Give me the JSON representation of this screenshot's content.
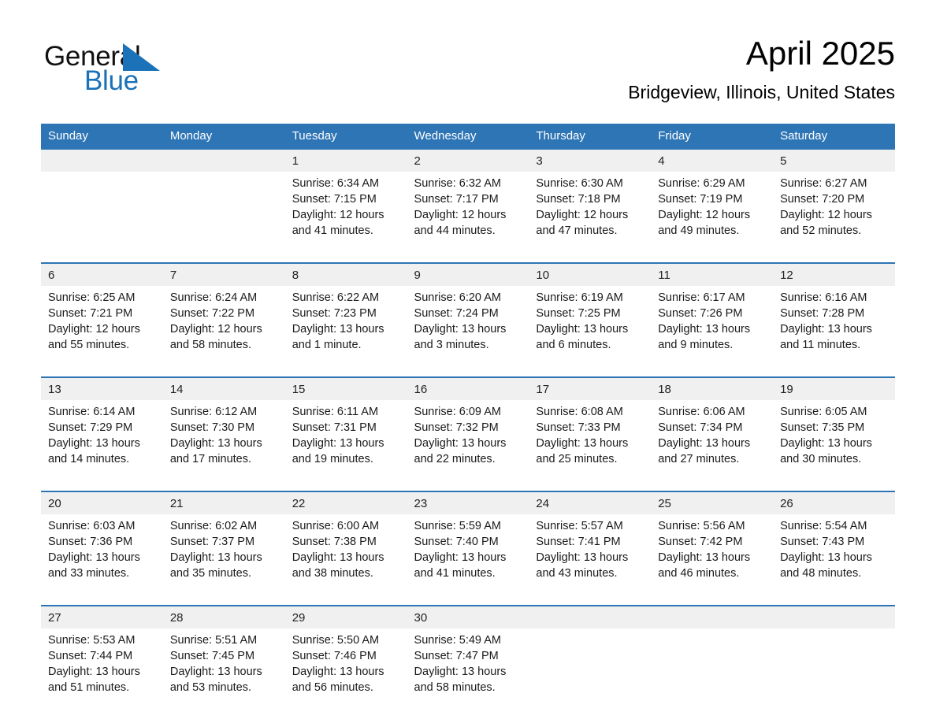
{
  "brand": {
    "name_part1": "General",
    "name_part2": "Blue",
    "accent_color": "#1b72b8"
  },
  "header": {
    "month_title": "April 2025",
    "location": "Bridgeview, Illinois, United States"
  },
  "theme": {
    "header_blue": "#2e75b6",
    "date_band_gray": "#f0f0f0",
    "page_background": "#ffffff"
  },
  "weekday_headers": [
    "Sunday",
    "Monday",
    "Tuesday",
    "Wednesday",
    "Thursday",
    "Friday",
    "Saturday"
  ],
  "weeks": [
    {
      "days": [
        {
          "date": "",
          "sunrise": "",
          "sunset": "",
          "daylight_line1": "",
          "daylight_line2": ""
        },
        {
          "date": "",
          "sunrise": "",
          "sunset": "",
          "daylight_line1": "",
          "daylight_line2": ""
        },
        {
          "date": "1",
          "sunrise": "Sunrise: 6:34 AM",
          "sunset": "Sunset: 7:15 PM",
          "daylight_line1": "Daylight: 12 hours",
          "daylight_line2": "and 41 minutes."
        },
        {
          "date": "2",
          "sunrise": "Sunrise: 6:32 AM",
          "sunset": "Sunset: 7:17 PM",
          "daylight_line1": "Daylight: 12 hours",
          "daylight_line2": "and 44 minutes."
        },
        {
          "date": "3",
          "sunrise": "Sunrise: 6:30 AM",
          "sunset": "Sunset: 7:18 PM",
          "daylight_line1": "Daylight: 12 hours",
          "daylight_line2": "and 47 minutes."
        },
        {
          "date": "4",
          "sunrise": "Sunrise: 6:29 AM",
          "sunset": "Sunset: 7:19 PM",
          "daylight_line1": "Daylight: 12 hours",
          "daylight_line2": "and 49 minutes."
        },
        {
          "date": "5",
          "sunrise": "Sunrise: 6:27 AM",
          "sunset": "Sunset: 7:20 PM",
          "daylight_line1": "Daylight: 12 hours",
          "daylight_line2": "and 52 minutes."
        }
      ]
    },
    {
      "days": [
        {
          "date": "6",
          "sunrise": "Sunrise: 6:25 AM",
          "sunset": "Sunset: 7:21 PM",
          "daylight_line1": "Daylight: 12 hours",
          "daylight_line2": "and 55 minutes."
        },
        {
          "date": "7",
          "sunrise": "Sunrise: 6:24 AM",
          "sunset": "Sunset: 7:22 PM",
          "daylight_line1": "Daylight: 12 hours",
          "daylight_line2": "and 58 minutes."
        },
        {
          "date": "8",
          "sunrise": "Sunrise: 6:22 AM",
          "sunset": "Sunset: 7:23 PM",
          "daylight_line1": "Daylight: 13 hours",
          "daylight_line2": "and 1 minute."
        },
        {
          "date": "9",
          "sunrise": "Sunrise: 6:20 AM",
          "sunset": "Sunset: 7:24 PM",
          "daylight_line1": "Daylight: 13 hours",
          "daylight_line2": "and 3 minutes."
        },
        {
          "date": "10",
          "sunrise": "Sunrise: 6:19 AM",
          "sunset": "Sunset: 7:25 PM",
          "daylight_line1": "Daylight: 13 hours",
          "daylight_line2": "and 6 minutes."
        },
        {
          "date": "11",
          "sunrise": "Sunrise: 6:17 AM",
          "sunset": "Sunset: 7:26 PM",
          "daylight_line1": "Daylight: 13 hours",
          "daylight_line2": "and 9 minutes."
        },
        {
          "date": "12",
          "sunrise": "Sunrise: 6:16 AM",
          "sunset": "Sunset: 7:28 PM",
          "daylight_line1": "Daylight: 13 hours",
          "daylight_line2": "and 11 minutes."
        }
      ]
    },
    {
      "days": [
        {
          "date": "13",
          "sunrise": "Sunrise: 6:14 AM",
          "sunset": "Sunset: 7:29 PM",
          "daylight_line1": "Daylight: 13 hours",
          "daylight_line2": "and 14 minutes."
        },
        {
          "date": "14",
          "sunrise": "Sunrise: 6:12 AM",
          "sunset": "Sunset: 7:30 PM",
          "daylight_line1": "Daylight: 13 hours",
          "daylight_line2": "and 17 minutes."
        },
        {
          "date": "15",
          "sunrise": "Sunrise: 6:11 AM",
          "sunset": "Sunset: 7:31 PM",
          "daylight_line1": "Daylight: 13 hours",
          "daylight_line2": "and 19 minutes."
        },
        {
          "date": "16",
          "sunrise": "Sunrise: 6:09 AM",
          "sunset": "Sunset: 7:32 PM",
          "daylight_line1": "Daylight: 13 hours",
          "daylight_line2": "and 22 minutes."
        },
        {
          "date": "17",
          "sunrise": "Sunrise: 6:08 AM",
          "sunset": "Sunset: 7:33 PM",
          "daylight_line1": "Daylight: 13 hours",
          "daylight_line2": "and 25 minutes."
        },
        {
          "date": "18",
          "sunrise": "Sunrise: 6:06 AM",
          "sunset": "Sunset: 7:34 PM",
          "daylight_line1": "Daylight: 13 hours",
          "daylight_line2": "and 27 minutes."
        },
        {
          "date": "19",
          "sunrise": "Sunrise: 6:05 AM",
          "sunset": "Sunset: 7:35 PM",
          "daylight_line1": "Daylight: 13 hours",
          "daylight_line2": "and 30 minutes."
        }
      ]
    },
    {
      "days": [
        {
          "date": "20",
          "sunrise": "Sunrise: 6:03 AM",
          "sunset": "Sunset: 7:36 PM",
          "daylight_line1": "Daylight: 13 hours",
          "daylight_line2": "and 33 minutes."
        },
        {
          "date": "21",
          "sunrise": "Sunrise: 6:02 AM",
          "sunset": "Sunset: 7:37 PM",
          "daylight_line1": "Daylight: 13 hours",
          "daylight_line2": "and 35 minutes."
        },
        {
          "date": "22",
          "sunrise": "Sunrise: 6:00 AM",
          "sunset": "Sunset: 7:38 PM",
          "daylight_line1": "Daylight: 13 hours",
          "daylight_line2": "and 38 minutes."
        },
        {
          "date": "23",
          "sunrise": "Sunrise: 5:59 AM",
          "sunset": "Sunset: 7:40 PM",
          "daylight_line1": "Daylight: 13 hours",
          "daylight_line2": "and 41 minutes."
        },
        {
          "date": "24",
          "sunrise": "Sunrise: 5:57 AM",
          "sunset": "Sunset: 7:41 PM",
          "daylight_line1": "Daylight: 13 hours",
          "daylight_line2": "and 43 minutes."
        },
        {
          "date": "25",
          "sunrise": "Sunrise: 5:56 AM",
          "sunset": "Sunset: 7:42 PM",
          "daylight_line1": "Daylight: 13 hours",
          "daylight_line2": "and 46 minutes."
        },
        {
          "date": "26",
          "sunrise": "Sunrise: 5:54 AM",
          "sunset": "Sunset: 7:43 PM",
          "daylight_line1": "Daylight: 13 hours",
          "daylight_line2": "and 48 minutes."
        }
      ]
    },
    {
      "days": [
        {
          "date": "27",
          "sunrise": "Sunrise: 5:53 AM",
          "sunset": "Sunset: 7:44 PM",
          "daylight_line1": "Daylight: 13 hours",
          "daylight_line2": "and 51 minutes."
        },
        {
          "date": "28",
          "sunrise": "Sunrise: 5:51 AM",
          "sunset": "Sunset: 7:45 PM",
          "daylight_line1": "Daylight: 13 hours",
          "daylight_line2": "and 53 minutes."
        },
        {
          "date": "29",
          "sunrise": "Sunrise: 5:50 AM",
          "sunset": "Sunset: 7:46 PM",
          "daylight_line1": "Daylight: 13 hours",
          "daylight_line2": "and 56 minutes."
        },
        {
          "date": "30",
          "sunrise": "Sunrise: 5:49 AM",
          "sunset": "Sunset: 7:47 PM",
          "daylight_line1": "Daylight: 13 hours",
          "daylight_line2": "and 58 minutes."
        },
        {
          "date": "",
          "sunrise": "",
          "sunset": "",
          "daylight_line1": "",
          "daylight_line2": ""
        },
        {
          "date": "",
          "sunrise": "",
          "sunset": "",
          "daylight_line1": "",
          "daylight_line2": ""
        },
        {
          "date": "",
          "sunrise": "",
          "sunset": "",
          "daylight_line1": "",
          "daylight_line2": ""
        }
      ]
    }
  ]
}
